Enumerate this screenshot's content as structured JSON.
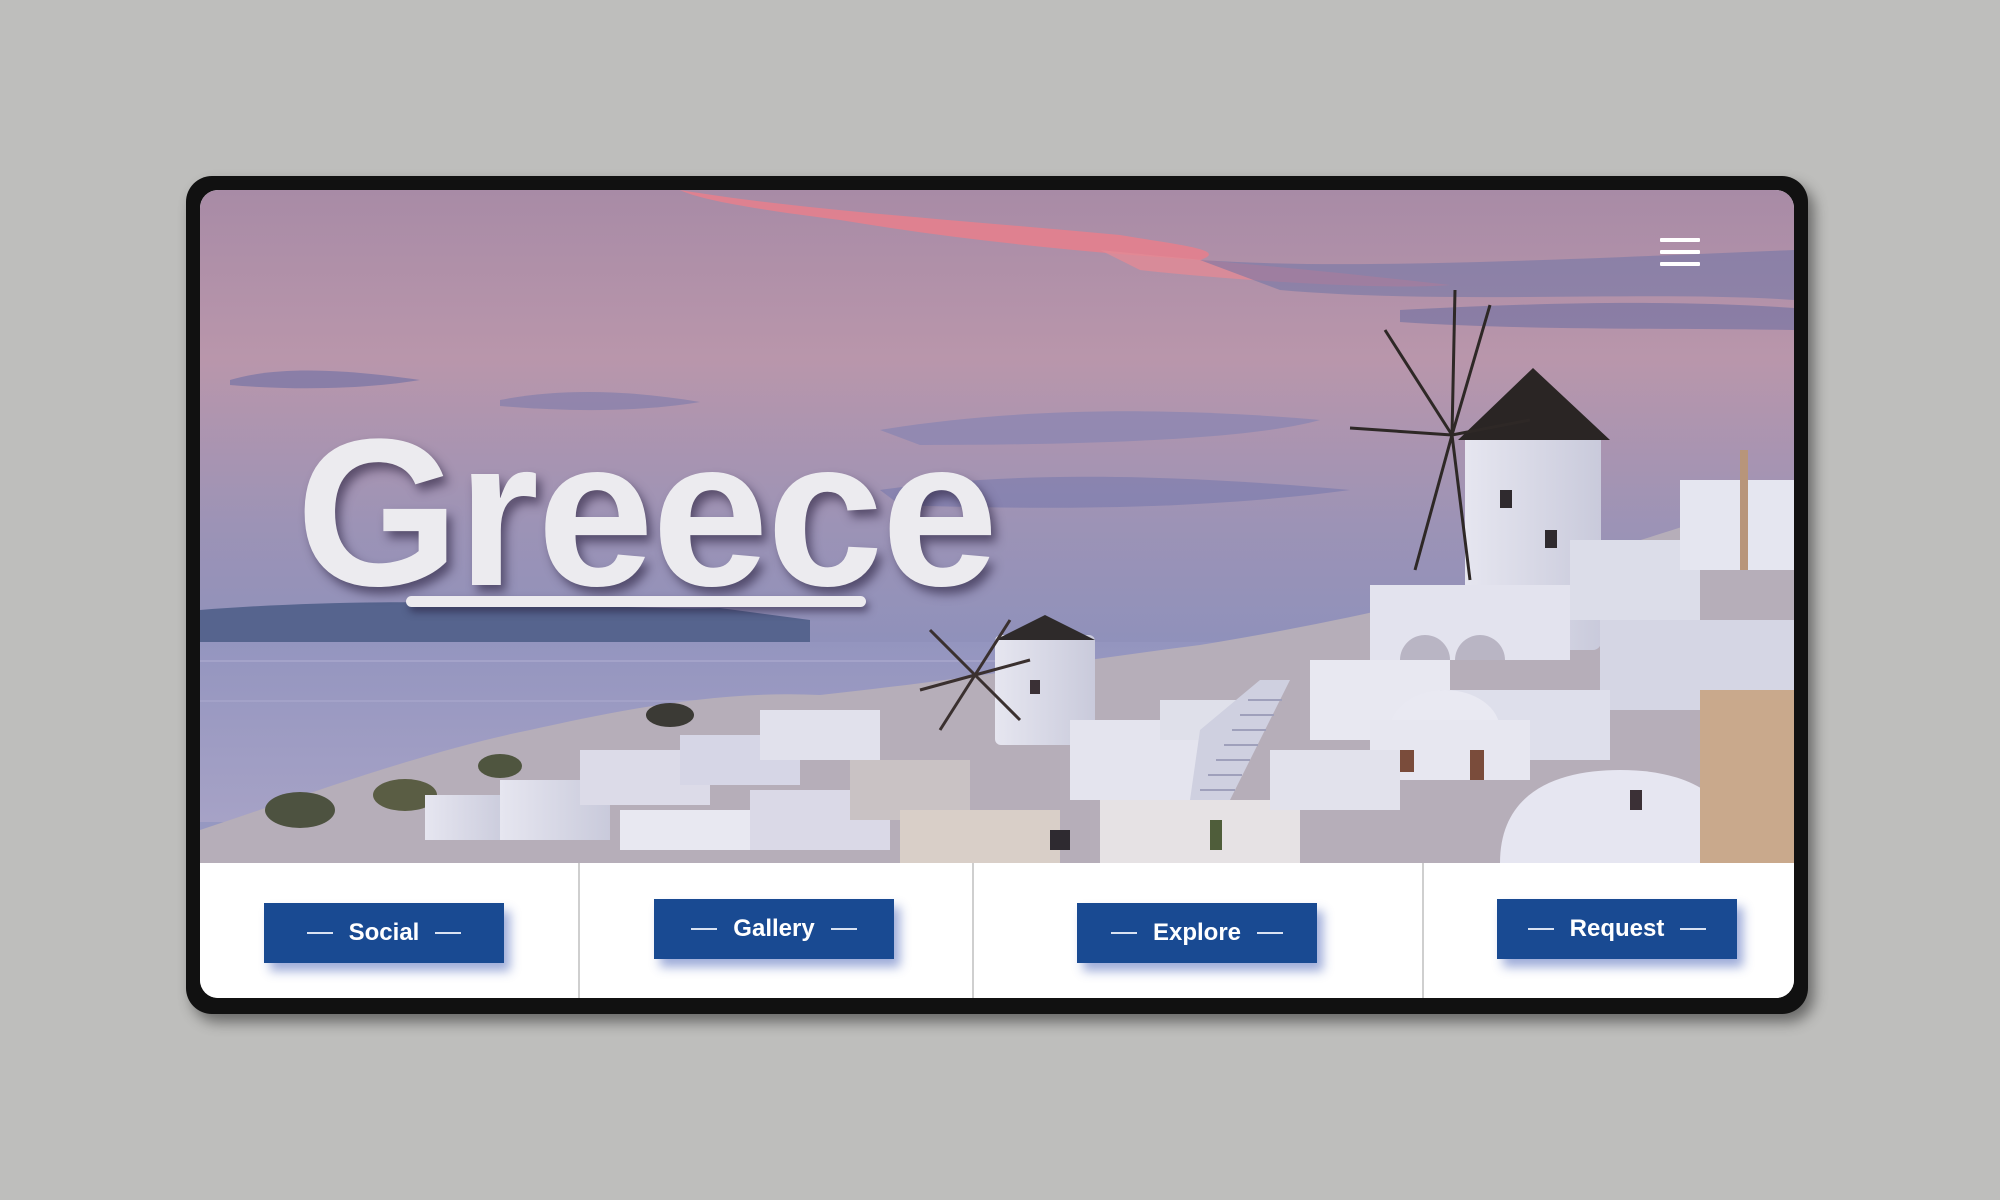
{
  "hero": {
    "title": "Greece",
    "menu_icon": "hamburger-menu-icon",
    "image_description_icon": "santorini-landscape"
  },
  "nav": {
    "buttons": [
      {
        "label": "Social"
      },
      {
        "label": "Gallery"
      },
      {
        "label": "Explore"
      },
      {
        "label": "Request"
      }
    ]
  },
  "colors": {
    "page_background": "#bebebc",
    "device_frame": "#111111",
    "button_blue": "#194a92",
    "title_text": "#ecebef"
  }
}
